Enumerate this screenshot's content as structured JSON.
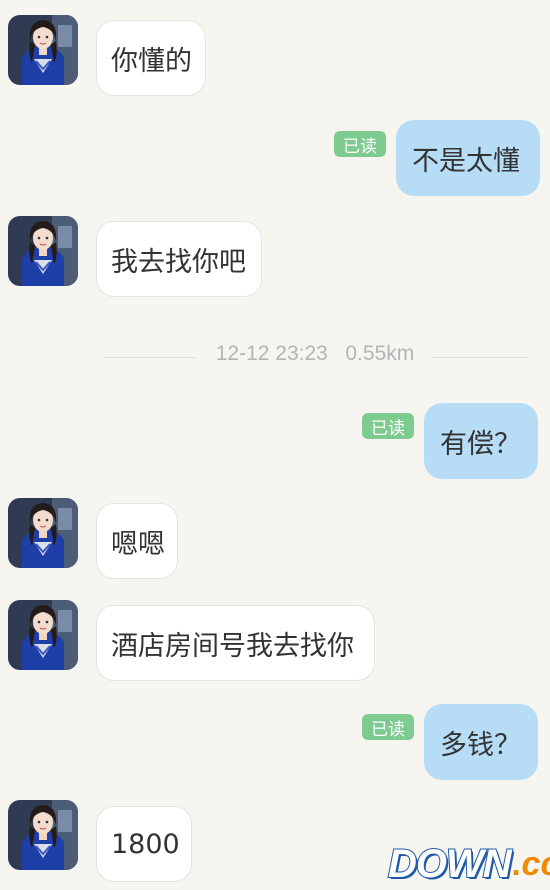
{
  "messages": [
    {
      "side": "in",
      "text": "你懂的"
    },
    {
      "side": "out",
      "text": "不是太懂",
      "status": "已读"
    },
    {
      "side": "in",
      "text": "我去找你吧"
    },
    {
      "side": "out",
      "text": "有偿？",
      "status": "已读"
    },
    {
      "side": "in",
      "text": "嗯嗯"
    },
    {
      "side": "in",
      "text": "酒店房间号我去找你"
    },
    {
      "side": "out",
      "text": "多钱？",
      "status": "已读"
    },
    {
      "side": "in",
      "text": "1800"
    }
  ],
  "separator": {
    "time": "12-12 23:23",
    "distance": "0.55km"
  },
  "watermark": {
    "main": "DOWN",
    "dot": ".",
    "suffix": "cc"
  },
  "colors": {
    "background": "#f7f5f0",
    "incoming_bubble": "#ffffff",
    "outgoing_bubble": "#b7dcf6",
    "read_badge": "#7ecb8f",
    "watermark_blue": "#1e5aa8",
    "watermark_orange": "#f08a00"
  },
  "icons": {
    "avatar": "contact-avatar-photo"
  }
}
